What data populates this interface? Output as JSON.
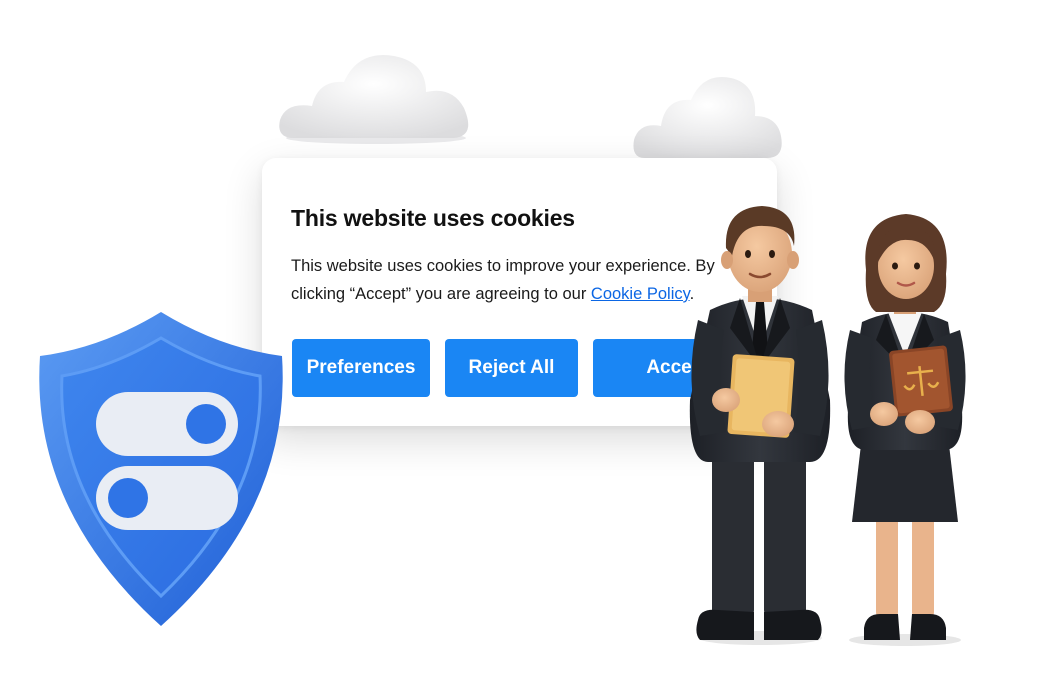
{
  "cookie_banner": {
    "title": "This website uses cookies",
    "body_line1": "This website uses cookies to improve your experience. By",
    "body_line2_prefix": "clicking “Accept” you are agreeing to our ",
    "policy_link": "Cookie Policy",
    "body_line2_suffix": ".",
    "buttons": {
      "preferences": "Preferences",
      "reject_all": "Reject All",
      "accept": "Accept"
    }
  },
  "colors": {
    "button_blue": "#1a86f4",
    "link_blue": "#0b66e4",
    "shield_blue": "#2f74e6",
    "suit_black": "#262a30"
  },
  "illustration": {
    "shield_icon": "shield-with-toggle-switches-icon",
    "cloud_icon": "cloud-icon",
    "people": "businessman-and-businesswoman-figures"
  }
}
